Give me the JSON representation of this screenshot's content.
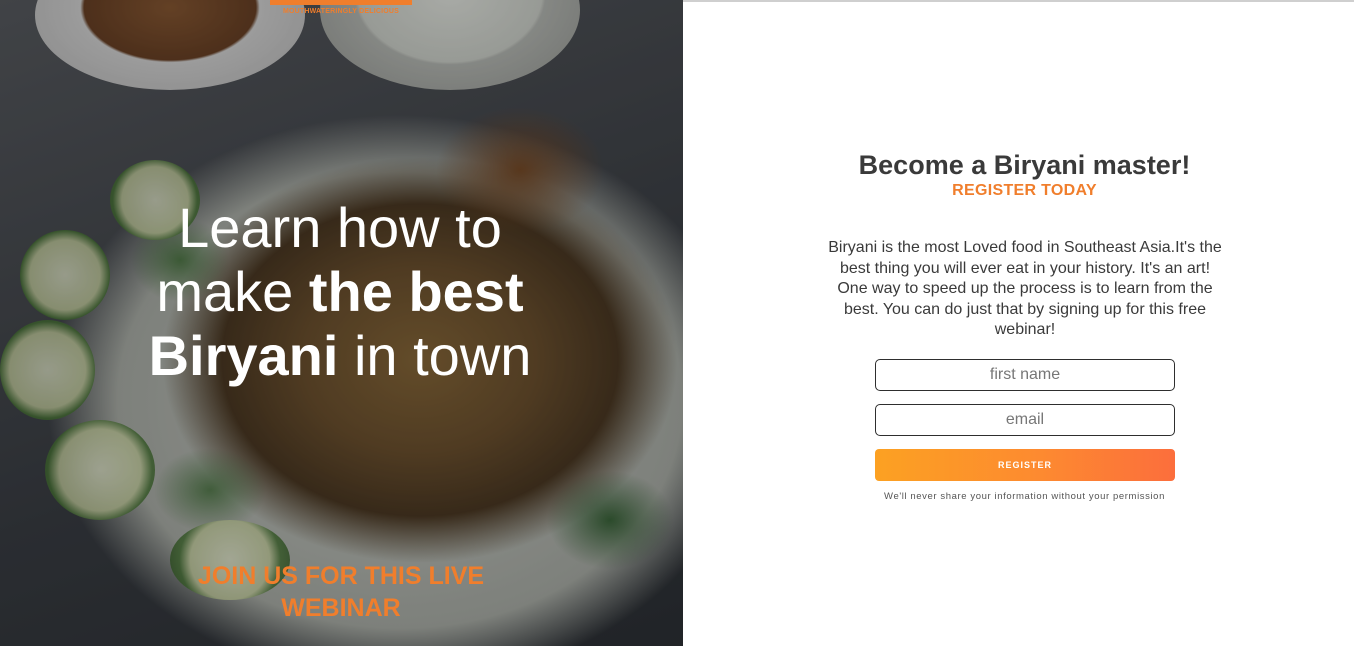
{
  "hero": {
    "brand_tag": "MOUTHWATERINGLY DELICIOUS",
    "headline": {
      "line1": "Learn how to",
      "line2_light": "make ",
      "line2_bold": "the best",
      "line3_bold": "Biryani",
      "line3_light": " in town"
    },
    "cta_line1": "JOIN US FOR THIS LIVE",
    "cta_line2": "WEBINAR"
  },
  "form": {
    "title": "Become a Biryani master!",
    "subtitle": "REGISTER TODAY",
    "description": "Biryani is the most Loved food in Southeast Asia.It's the best thing you will ever eat in your history. It's an art! One way to speed up the process is to learn from the best. You can do just that by signing up for this free webinar!",
    "first_name_placeholder": "first name",
    "email_placeholder": "email",
    "register_label": "REGISTER",
    "privacy_note": "We'll never share your information without your permission"
  },
  "colors": {
    "accent": "#f07e2c",
    "button_start": "#fca122",
    "button_end": "#fc6e3c",
    "heading_text": "#3a3a3a"
  }
}
